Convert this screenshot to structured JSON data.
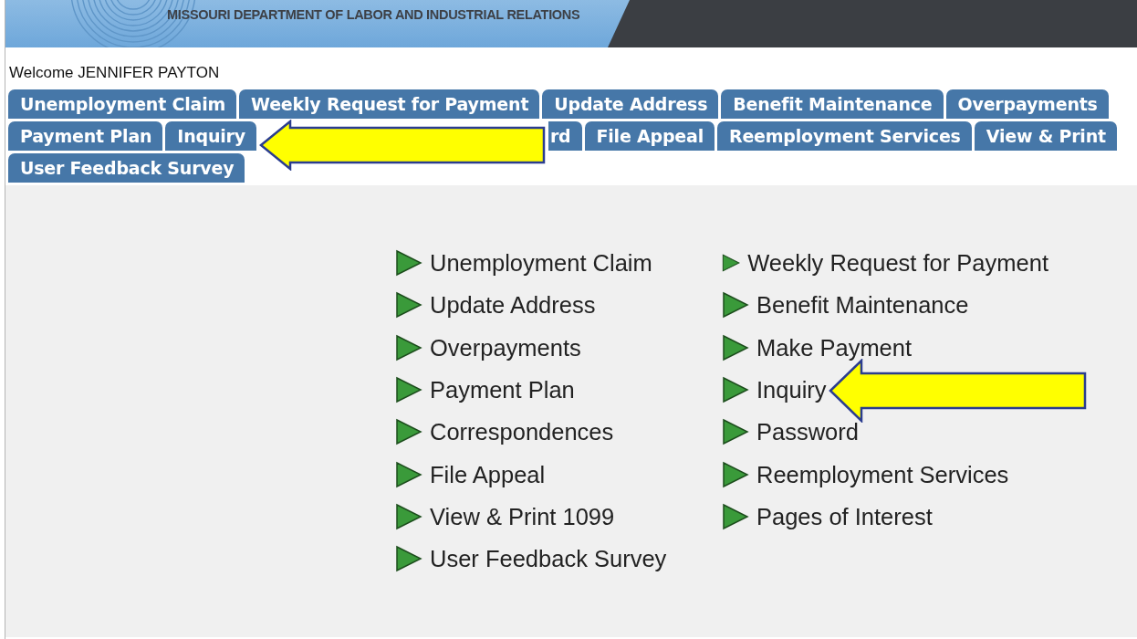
{
  "header": {
    "title": "MISSOURI DEPARTMENT OF LABOR AND INDUSTRIAL RELATIONS"
  },
  "welcome": "Welcome JENNIFER PAYTON",
  "tab_rows": [
    {
      "tabs": [
        {
          "label": "Unemployment Claim"
        },
        {
          "label": "Weekly Request for Payment"
        },
        {
          "label": "Update Address"
        },
        {
          "label": "Benefit Maintenance"
        },
        {
          "label": "Overpayments"
        }
      ]
    },
    {
      "tabs": [
        {
          "label": "Payment Plan"
        },
        {
          "label": "Inquiry"
        },
        {
          "label": "rd",
          "kind": "covered"
        },
        {
          "label": "File Appeal"
        },
        {
          "label": "Reemployment Services"
        },
        {
          "label": "View & Print"
        }
      ]
    },
    {
      "tabs": [
        {
          "label": "User Feedback Survey"
        }
      ]
    }
  ],
  "links": {
    "column_1": [
      "Unemployment Claim",
      "Update Address",
      "Overpayments",
      "Payment Plan",
      "Correspondences",
      "File Appeal",
      "View & Print 1099",
      "User Feedback Survey"
    ],
    "column_2": [
      "Weekly Request for Payment",
      "Benefit Maintenance",
      "Make Payment",
      "Inquiry",
      "Password",
      "Reemployment Services",
      "Pages of Interest"
    ]
  }
}
